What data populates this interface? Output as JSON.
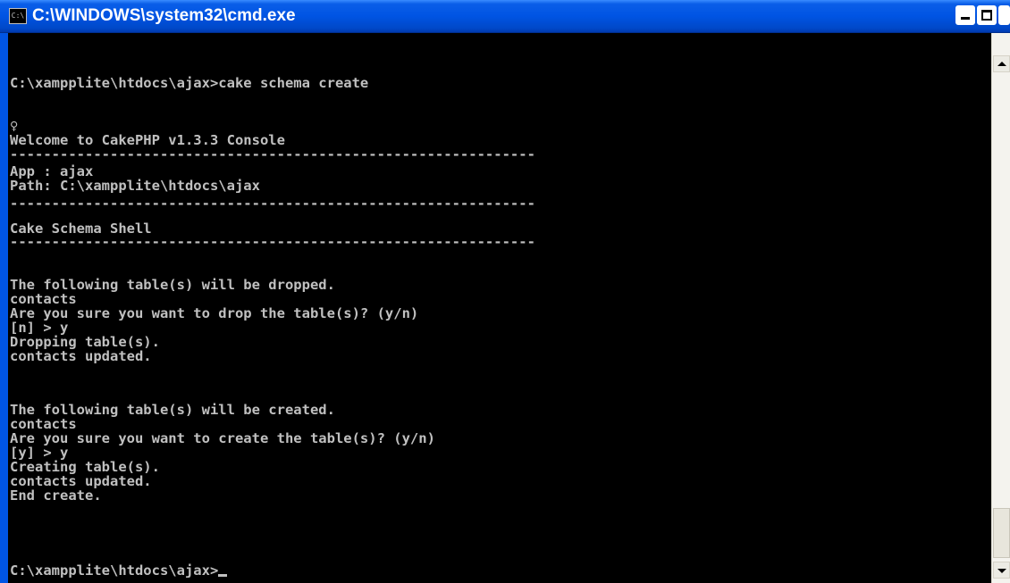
{
  "window": {
    "title": "C:\\WINDOWS\\system32\\cmd.exe",
    "icon": "cmd-icon"
  },
  "colors": {
    "titlebar": "#0054e3",
    "console_bg": "#000000",
    "console_text": "#c0c0c0"
  },
  "console": {
    "lines": [
      "C:\\xampplite\\htdocs\\ajax>cake schema create",
      "",
      "♀",
      "Welcome to CakePHP v1.3.3 Console",
      "---------------------------------------------------------------",
      "App : ajax",
      "Path: C:\\xampplite\\htdocs\\ajax",
      "---------------------------------------------------------------",
      "Cake Schema Shell",
      "---------------------------------------------------------------",
      "",
      "The following table(s) will be dropped.",
      "contacts",
      "Are you sure you want to drop the table(s)? (y/n)",
      "[n] > y",
      "Dropping table(s).",
      "contacts updated.",
      "",
      "The following table(s) will be created.",
      "contacts",
      "Are you sure you want to create the table(s)? (y/n)",
      "[y] > y",
      "Creating table(s).",
      "contacts updated.",
      "End create.",
      "",
      "",
      "C:\\xampplite\\htdocs\\ajax>"
    ]
  }
}
